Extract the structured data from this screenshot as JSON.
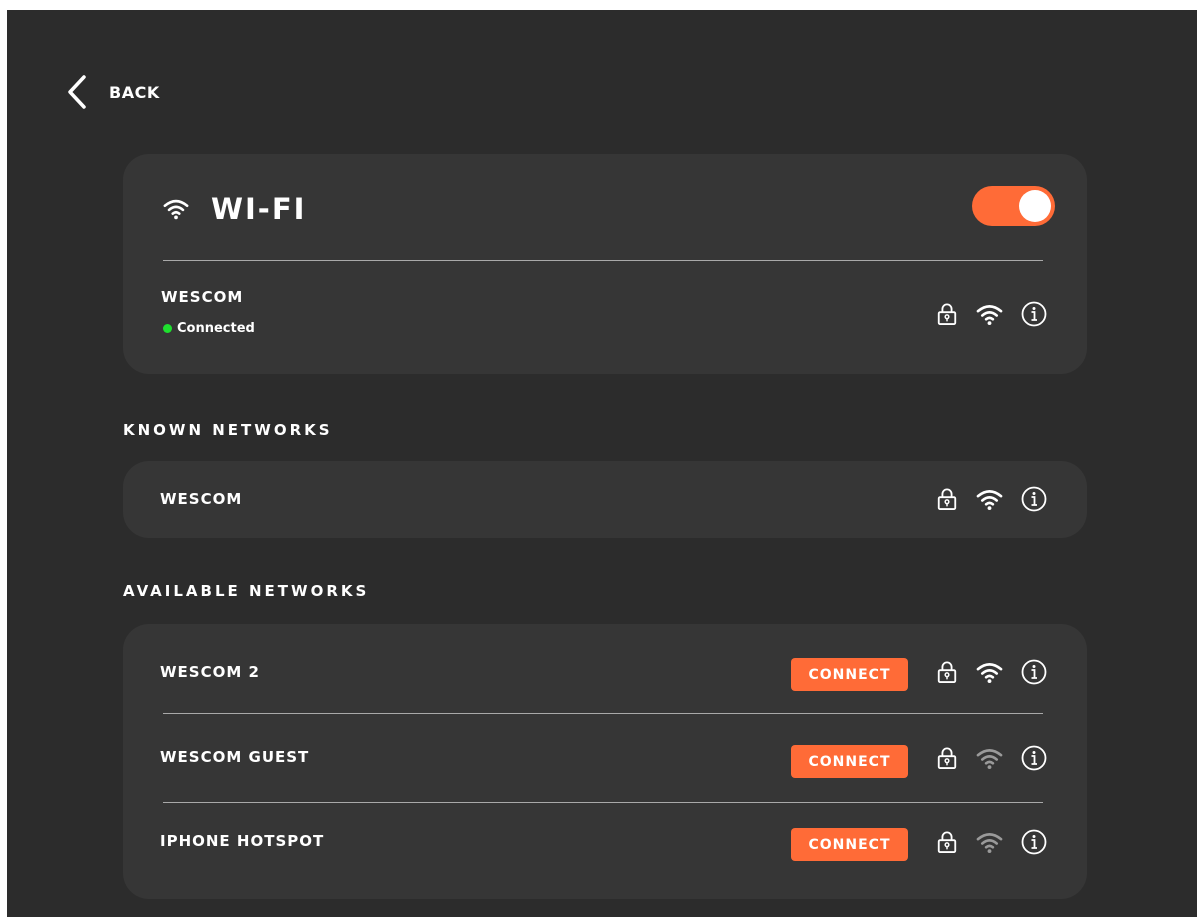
{
  "colors": {
    "background": "#2c2c2c",
    "card": "#363636",
    "accent": "#ff6b37",
    "connected": "#1ee02e",
    "text": "#ffffff",
    "weak_signal": "#9a9a9a"
  },
  "header": {
    "back_icon": "chevron-left-icon",
    "back_label": "BACK"
  },
  "wifi": {
    "icon": "wifi-icon",
    "title": "WI-FI",
    "enabled": true,
    "current_network": {
      "name": "WESCOM",
      "status": "Connected",
      "secured": true,
      "signal": "strong"
    }
  },
  "known_networks": {
    "title": "KNOWN NETWORKS",
    "items": [
      {
        "name": "WESCOM",
        "secured": true,
        "signal": "strong"
      }
    ]
  },
  "available_networks": {
    "title": "AVAILABLE NETWORKS",
    "items": [
      {
        "name": "WESCOM 2",
        "connect_label": "CONNECT",
        "secured": true,
        "signal": "strong"
      },
      {
        "name": "WESCOM GUEST",
        "connect_label": "CONNECT",
        "secured": true,
        "signal": "weak"
      },
      {
        "name": "IPHONE HOTSPOT",
        "connect_label": "CONNECT",
        "secured": true,
        "signal": "weak"
      }
    ]
  },
  "icons": {
    "lock": "lock-icon",
    "signal": "wifi-signal-icon",
    "info": "info-icon"
  }
}
